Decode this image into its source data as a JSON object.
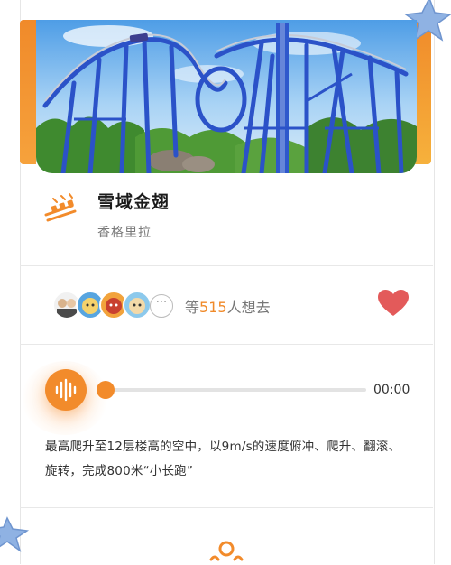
{
  "attraction": {
    "title": "雪域金翅",
    "area": "香格里拉"
  },
  "social": {
    "prefix": "等",
    "count": "515",
    "suffix": "人想去",
    "more_icon": "ellipsis-icon",
    "favorited": true
  },
  "audio": {
    "time": "00:00",
    "progress": 0,
    "icon": "sound-wave-icon"
  },
  "description": "最高爬升至12层楼高的空中，以9m/s的速度俯冲、爬升、翻滚、旋转，完成800米“小长跑”",
  "colors": {
    "accent": "#f28b2b",
    "heart": "#e35a5a",
    "track": "#e3e3e3",
    "coaster": "#2b52c8",
    "star": "#7fa6dc"
  }
}
